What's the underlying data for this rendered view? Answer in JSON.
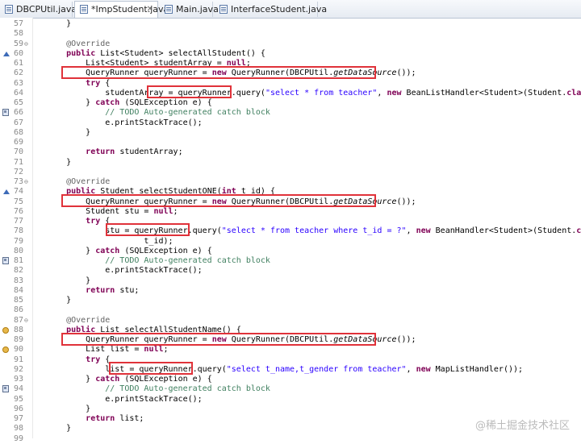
{
  "tabs": [
    {
      "label": "DBCPUtil.java",
      "active": false
    },
    {
      "label": "*ImpStudent.java",
      "active": true,
      "close": "✕"
    },
    {
      "label": "Main.java",
      "active": false
    },
    {
      "label": "InterfaceStudent.java",
      "active": false
    }
  ],
  "lines": [
    {
      "n": "57",
      "segs": [
        {
          "t": "    }"
        }
      ]
    },
    {
      "n": "58",
      "segs": []
    },
    {
      "n": "59",
      "fold": "⊖",
      "segs": [
        {
          "t": "    @Override",
          "c": "ann"
        }
      ]
    },
    {
      "n": "60",
      "marker": "tri",
      "segs": [
        {
          "t": "    "
        },
        {
          "t": "public",
          "c": "kw"
        },
        {
          "t": " List<Student> selectAllStudent() {"
        }
      ]
    },
    {
      "n": "61",
      "segs": [
        {
          "t": "        List<Student> studentArray = "
        },
        {
          "t": "null",
          "c": "kw"
        },
        {
          "t": ";"
        }
      ]
    },
    {
      "n": "62",
      "segs": [
        {
          "t": "        QueryRunner queryRunner = "
        },
        {
          "t": "new",
          "c": "kw"
        },
        {
          "t": " QueryRunner(DBCPUtil."
        },
        {
          "t": "getDataSource",
          "c": "ital"
        },
        {
          "t": "());"
        }
      ]
    },
    {
      "n": "63",
      "segs": [
        {
          "t": "        "
        },
        {
          "t": "try",
          "c": "kw"
        },
        {
          "t": " {"
        }
      ]
    },
    {
      "n": "64",
      "segs": [
        {
          "t": "            studentArray = queryRunner.query("
        },
        {
          "t": "\"select * from teacher\"",
          "c": "str"
        },
        {
          "t": ", "
        },
        {
          "t": "new",
          "c": "kw"
        },
        {
          "t": " BeanListHandler<Student>(Student."
        },
        {
          "t": "class",
          "c": "kw"
        },
        {
          "t": "));"
        }
      ]
    },
    {
      "n": "65",
      "segs": [
        {
          "t": "        } "
        },
        {
          "t": "catch",
          "c": "kw"
        },
        {
          "t": " (SQLException e) {"
        }
      ]
    },
    {
      "n": "66",
      "marker": "sq",
      "segs": [
        {
          "t": "            "
        },
        {
          "t": "// TODO Auto-generated catch block",
          "c": "cmt"
        }
      ]
    },
    {
      "n": "67",
      "segs": [
        {
          "t": "            e.printStackTrace();"
        }
      ]
    },
    {
      "n": "68",
      "segs": [
        {
          "t": "        }"
        }
      ]
    },
    {
      "n": "69",
      "segs": []
    },
    {
      "n": "70",
      "segs": [
        {
          "t": "        "
        },
        {
          "t": "return",
          "c": "kw"
        },
        {
          "t": " studentArray;"
        }
      ]
    },
    {
      "n": "71",
      "segs": [
        {
          "t": "    }"
        }
      ]
    },
    {
      "n": "72",
      "segs": []
    },
    {
      "n": "73",
      "fold": "⊖",
      "segs": [
        {
          "t": "    @Override",
          "c": "ann"
        }
      ]
    },
    {
      "n": "74",
      "marker": "tri",
      "segs": [
        {
          "t": "    "
        },
        {
          "t": "public",
          "c": "kw"
        },
        {
          "t": " Student selectStudentONE("
        },
        {
          "t": "int",
          "c": "kw"
        },
        {
          "t": " t_id) {"
        }
      ]
    },
    {
      "n": "75",
      "segs": [
        {
          "t": "        QueryRunner queryRunner = "
        },
        {
          "t": "new",
          "c": "kw"
        },
        {
          "t": " QueryRunner(DBCPUtil."
        },
        {
          "t": "getDataSource",
          "c": "ital"
        },
        {
          "t": "());"
        }
      ]
    },
    {
      "n": "76",
      "segs": [
        {
          "t": "        Student stu = "
        },
        {
          "t": "null",
          "c": "kw"
        },
        {
          "t": ";"
        }
      ]
    },
    {
      "n": "77",
      "segs": [
        {
          "t": "        "
        },
        {
          "t": "try",
          "c": "kw"
        },
        {
          "t": " {"
        }
      ]
    },
    {
      "n": "78",
      "segs": [
        {
          "t": "            stu = queryRunner.query("
        },
        {
          "t": "\"select * from teacher where t_id = ?\"",
          "c": "str"
        },
        {
          "t": ", "
        },
        {
          "t": "new",
          "c": "kw"
        },
        {
          "t": " BeanHandler<Student>(Student."
        },
        {
          "t": "class",
          "c": "kw"
        },
        {
          "t": "),"
        }
      ]
    },
    {
      "n": "79",
      "segs": [
        {
          "t": "                    t_id);"
        }
      ]
    },
    {
      "n": "80",
      "segs": [
        {
          "t": "        } "
        },
        {
          "t": "catch",
          "c": "kw"
        },
        {
          "t": " (SQLException e) {"
        }
      ]
    },
    {
      "n": "81",
      "marker": "sq",
      "segs": [
        {
          "t": "            "
        },
        {
          "t": "// TODO Auto-generated catch block",
          "c": "cmt"
        }
      ]
    },
    {
      "n": "82",
      "segs": [
        {
          "t": "            e.printStackTrace();"
        }
      ]
    },
    {
      "n": "83",
      "segs": [
        {
          "t": "        }"
        }
      ]
    },
    {
      "n": "84",
      "segs": [
        {
          "t": "        "
        },
        {
          "t": "return",
          "c": "kw"
        },
        {
          "t": " stu;"
        }
      ]
    },
    {
      "n": "85",
      "segs": [
        {
          "t": "    }"
        }
      ]
    },
    {
      "n": "86",
      "segs": []
    },
    {
      "n": "87",
      "fold": "⊖",
      "segs": [
        {
          "t": "    @Override",
          "c": "ann"
        }
      ]
    },
    {
      "n": "88",
      "marker": "warn",
      "segs": [
        {
          "t": "    "
        },
        {
          "t": "public",
          "c": "kw"
        },
        {
          "t": " List selectAllStudentName() {"
        }
      ]
    },
    {
      "n": "89",
      "segs": [
        {
          "t": "        QueryRunner queryRunner = "
        },
        {
          "t": "new",
          "c": "kw"
        },
        {
          "t": " QueryRunner(DBCPUtil."
        },
        {
          "t": "getDataSource",
          "c": "ital"
        },
        {
          "t": "());"
        }
      ]
    },
    {
      "n": "90",
      "marker": "warn",
      "segs": [
        {
          "t": "        List list = "
        },
        {
          "t": "null",
          "c": "kw"
        },
        {
          "t": ";"
        }
      ]
    },
    {
      "n": "91",
      "segs": [
        {
          "t": "        "
        },
        {
          "t": "try",
          "c": "kw"
        },
        {
          "t": " {"
        }
      ]
    },
    {
      "n": "92",
      "segs": [
        {
          "t": "            list = queryRunner.query("
        },
        {
          "t": "\"select t_name,t_gender from teacher\"",
          "c": "str"
        },
        {
          "t": ", "
        },
        {
          "t": "new",
          "c": "kw"
        },
        {
          "t": " MapListHandler());"
        }
      ]
    },
    {
      "n": "93",
      "segs": [
        {
          "t": "        } "
        },
        {
          "t": "catch",
          "c": "kw"
        },
        {
          "t": " (SQLException e) {"
        }
      ]
    },
    {
      "n": "94",
      "marker": "sq",
      "segs": [
        {
          "t": "            "
        },
        {
          "t": "// TODO Auto-generated catch block",
          "c": "cmt"
        }
      ]
    },
    {
      "n": "95",
      "segs": [
        {
          "t": "            e.printStackTrace();"
        }
      ]
    },
    {
      "n": "96",
      "segs": [
        {
          "t": "        }"
        }
      ]
    },
    {
      "n": "97",
      "segs": [
        {
          "t": "        "
        },
        {
          "t": "return",
          "c": "kw"
        },
        {
          "t": " list;"
        }
      ]
    },
    {
      "n": "98",
      "segs": [
        {
          "t": "    }"
        }
      ]
    },
    {
      "n": "99",
      "segs": []
    }
  ],
  "watermark": "@稀土掘金技术社区"
}
